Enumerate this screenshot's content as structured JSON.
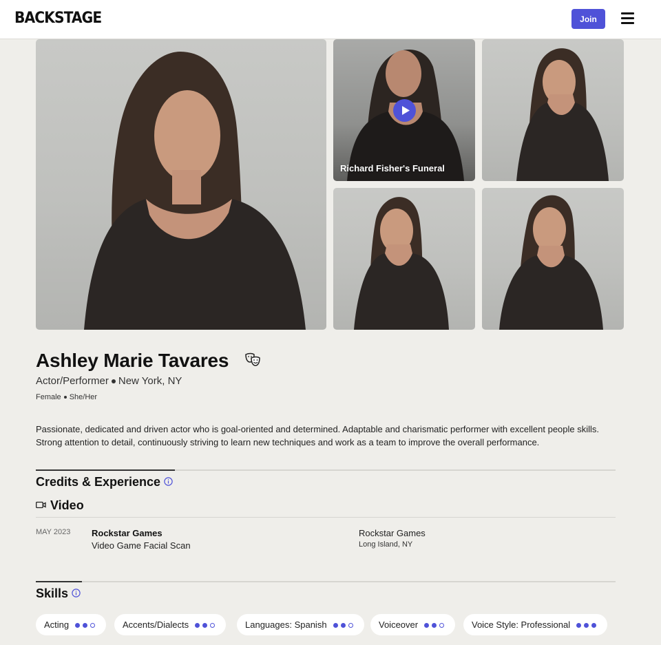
{
  "header": {
    "logo": "BACKSTAGE",
    "join_label": "Join",
    "accent_color": "#4f52d8",
    "menu_icon": "hamburger-menu-icon"
  },
  "media": {
    "video_caption": "Richard Fisher's Funeral",
    "play_icon": "play-icon"
  },
  "profile": {
    "name": "Ashley Marie Tavares",
    "name_icon": "theater-masks-icon",
    "role": "Actor/Performer",
    "location": "New York, NY",
    "gender": "Female",
    "pronouns": "She/Her",
    "bio": "Passionate, dedicated and driven actor who is goal-oriented and determined. Adaptable and charismatic performer with excellent people skills. Strong attention to detail, continuously striving to learn new techniques and work as a team to improve the overall performance."
  },
  "credits": {
    "title": "Credits & Experience",
    "category": "Video",
    "items": [
      {
        "date": "MAY 2023",
        "project": "Rockstar Games",
        "role": "Video Game Facial Scan",
        "company": "Rockstar Games",
        "location": "Long Island, NY"
      }
    ]
  },
  "skills": {
    "title": "Skills",
    "items": [
      {
        "label": "Acting",
        "level": 2,
        "max": 3
      },
      {
        "label": "Accents/Dialects",
        "level": 2,
        "max": 3
      },
      {
        "label": "Languages: Spanish",
        "level": 2,
        "max": 3
      },
      {
        "label": "Voiceover",
        "level": 2,
        "max": 3
      },
      {
        "label": "Voice Style: Professional",
        "level": 3,
        "max": 3
      }
    ]
  }
}
